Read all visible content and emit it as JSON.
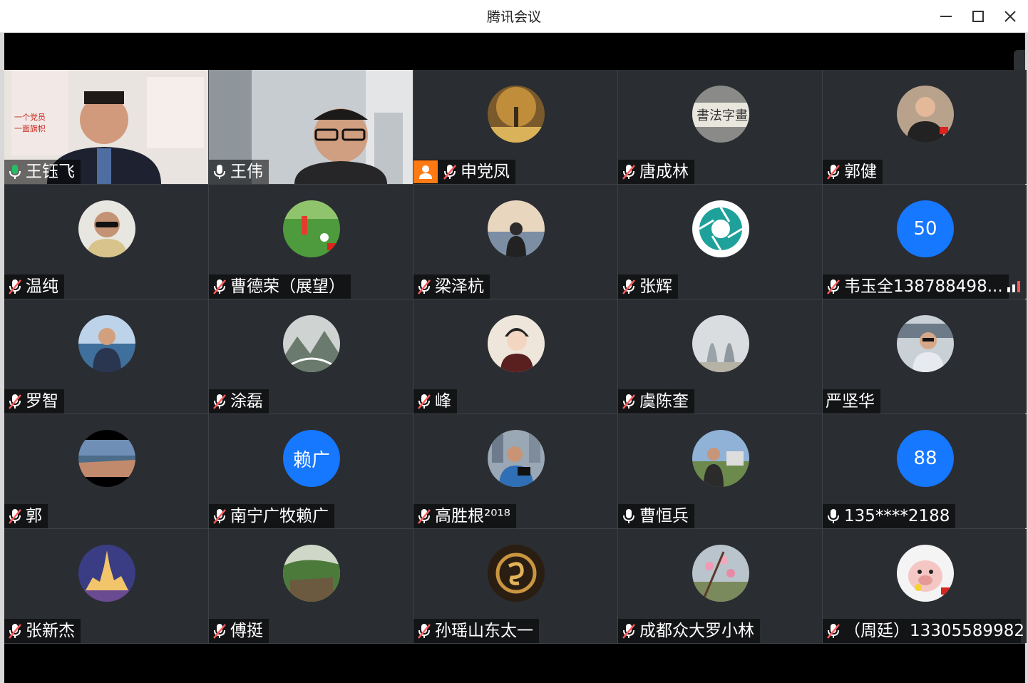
{
  "window": {
    "title": "腾讯会议",
    "controls": [
      "minimize-icon",
      "maximize-icon",
      "close-icon"
    ]
  },
  "colors": {
    "tile_bg": "#2a2d31",
    "grid_line": "#3e4146",
    "active_speaker": "#22c063",
    "host_badge": "#ff7a12",
    "text_avatar": "#1677ff",
    "mic_active": "#22c063",
    "mic_muted": "#ff5a5a"
  },
  "participants": [
    {
      "name": "王钰飞",
      "mic": "active",
      "video": true,
      "active_speaker": true
    },
    {
      "name": "王伟",
      "mic": "on",
      "video": true
    },
    {
      "name": "申党凤",
      "mic": "muted",
      "host": true,
      "avatar_icon": "autumn-tree-photo-icon"
    },
    {
      "name": "唐成林",
      "mic": "muted",
      "avatar_icon": "calligraphy-photo-icon"
    },
    {
      "name": "郭健",
      "mic": "muted",
      "avatar_icon": "man-portrait-photo-icon"
    },
    {
      "name": "温纯",
      "mic": "muted",
      "avatar_icon": "man-sunglasses-photo-icon"
    },
    {
      "name": "曹德荣（展望）",
      "mic": "muted",
      "avatar_icon": "football-photo-icon"
    },
    {
      "name": "梁泽杭",
      "mic": "muted",
      "avatar_icon": "sunset-lake-photo-icon"
    },
    {
      "name": "张辉",
      "mic": "muted",
      "avatar_icon": "shutter-logo-icon"
    },
    {
      "name": "韦玉全138788498...",
      "mic": "muted",
      "avatar_text": "50",
      "signal": true
    },
    {
      "name": "罗智",
      "mic": "muted",
      "avatar_icon": "man-lakeside-photo-icon"
    },
    {
      "name": "涂磊",
      "mic": "muted",
      "avatar_icon": "misty-mountain-photo-icon"
    },
    {
      "name": "峰",
      "mic": "muted",
      "avatar_icon": "cartoon-man-icon"
    },
    {
      "name": "虞陈奎",
      "mic": "muted",
      "avatar_icon": "twin-towers-photo-icon"
    },
    {
      "name": "严坚华",
      "mic": "none",
      "avatar_icon": "man-car-photo-icon"
    },
    {
      "name": "郭",
      "mic": "muted",
      "avatar_icon": "river-valley-photo-icon"
    },
    {
      "name": "南宁广牧赖广",
      "mic": "muted",
      "avatar_text": "赖广"
    },
    {
      "name": "高胜根²⁰¹⁸",
      "mic": "muted",
      "avatar_icon": "man-camera-photo-icon"
    },
    {
      "name": "曹恒兵",
      "mic": "on",
      "avatar_icon": "man-city-photo-icon"
    },
    {
      "name": "135****2188",
      "mic": "on",
      "avatar_text": "88"
    },
    {
      "name": "张新杰",
      "mic": "muted",
      "avatar_icon": "castle-night-photo-icon"
    },
    {
      "name": "傅挺",
      "mic": "muted",
      "avatar_icon": "green-cliff-photo-icon"
    },
    {
      "name": "孙瑶山东太一",
      "mic": "muted",
      "avatar_icon": "gold-emblem-icon"
    },
    {
      "name": "成都众大罗小林",
      "mic": "muted",
      "avatar_icon": "peach-blossom-photo-icon"
    },
    {
      "name": "（周廷）13305589982",
      "mic": "muted",
      "avatar_icon": "piglet-photo-icon"
    }
  ]
}
